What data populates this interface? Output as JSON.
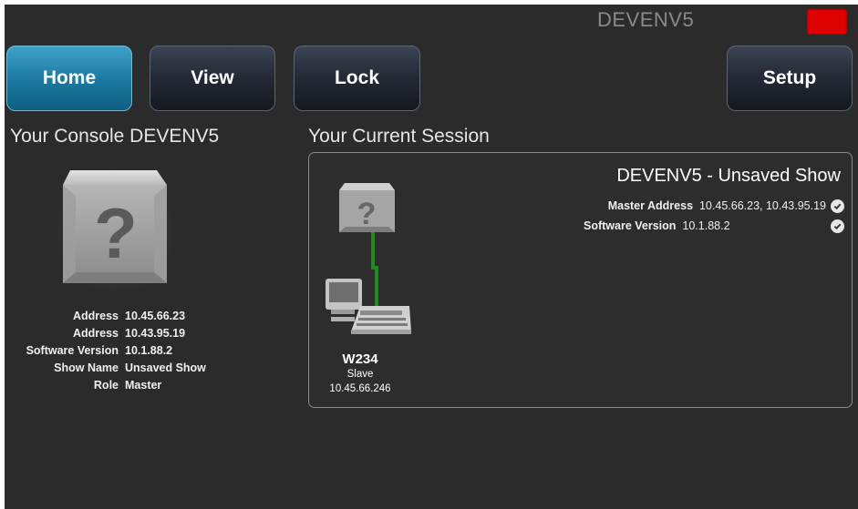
{
  "header": {
    "title": "DEVENV5",
    "status_color": "#e00000"
  },
  "nav": {
    "home": "Home",
    "view": "View",
    "lock": "Lock",
    "setup": "Setup",
    "active": "Home"
  },
  "console": {
    "heading": "Your Console DEVENV5",
    "icon": "unknown-console-cube-icon",
    "rows": [
      {
        "label": "Address",
        "value": "10.45.66.23"
      },
      {
        "label": "Address",
        "value": "10.43.95.19"
      },
      {
        "label": "Software Version",
        "value": "10.1.88.2"
      },
      {
        "label": "Show Name",
        "value": "Unsaved Show"
      },
      {
        "label": "Role",
        "value": "Master"
      }
    ]
  },
  "session": {
    "heading": "Your Current Session",
    "show_title": "DEVENV5 - Unsaved Show",
    "master_address_label": "Master Address",
    "master_address_value": "10.45.66.23, 10.43.95.19",
    "software_version_label": "Software Version",
    "software_version_value": "10.1.88.2",
    "status_icon": "check-circle-icon",
    "link_color": "#1e8c1e",
    "node": {
      "name": "W234",
      "role": "Slave",
      "address": "10.45.66.246",
      "icon": "console-workstation-icon"
    }
  }
}
